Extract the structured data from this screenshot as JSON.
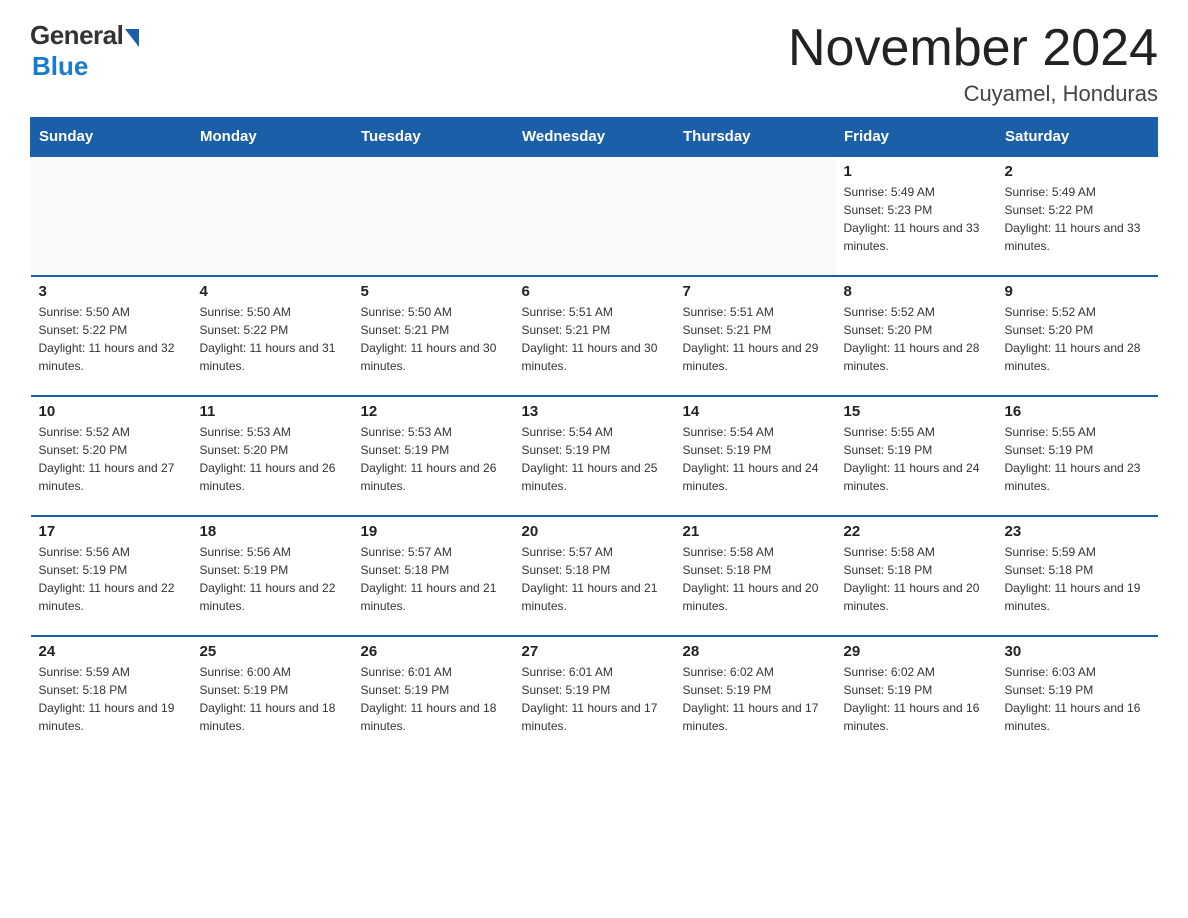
{
  "logo": {
    "general": "General",
    "blue": "Blue"
  },
  "title": "November 2024",
  "subtitle": "Cuyamel, Honduras",
  "days_of_week": [
    "Sunday",
    "Monday",
    "Tuesday",
    "Wednesday",
    "Thursday",
    "Friday",
    "Saturday"
  ],
  "weeks": [
    [
      {
        "day": "",
        "sunrise": "",
        "sunset": "",
        "daylight": ""
      },
      {
        "day": "",
        "sunrise": "",
        "sunset": "",
        "daylight": ""
      },
      {
        "day": "",
        "sunrise": "",
        "sunset": "",
        "daylight": ""
      },
      {
        "day": "",
        "sunrise": "",
        "sunset": "",
        "daylight": ""
      },
      {
        "day": "",
        "sunrise": "",
        "sunset": "",
        "daylight": ""
      },
      {
        "day": "1",
        "sunrise": "Sunrise: 5:49 AM",
        "sunset": "Sunset: 5:23 PM",
        "daylight": "Daylight: 11 hours and 33 minutes."
      },
      {
        "day": "2",
        "sunrise": "Sunrise: 5:49 AM",
        "sunset": "Sunset: 5:22 PM",
        "daylight": "Daylight: 11 hours and 33 minutes."
      }
    ],
    [
      {
        "day": "3",
        "sunrise": "Sunrise: 5:50 AM",
        "sunset": "Sunset: 5:22 PM",
        "daylight": "Daylight: 11 hours and 32 minutes."
      },
      {
        "day": "4",
        "sunrise": "Sunrise: 5:50 AM",
        "sunset": "Sunset: 5:22 PM",
        "daylight": "Daylight: 11 hours and 31 minutes."
      },
      {
        "day": "5",
        "sunrise": "Sunrise: 5:50 AM",
        "sunset": "Sunset: 5:21 PM",
        "daylight": "Daylight: 11 hours and 30 minutes."
      },
      {
        "day": "6",
        "sunrise": "Sunrise: 5:51 AM",
        "sunset": "Sunset: 5:21 PM",
        "daylight": "Daylight: 11 hours and 30 minutes."
      },
      {
        "day": "7",
        "sunrise": "Sunrise: 5:51 AM",
        "sunset": "Sunset: 5:21 PM",
        "daylight": "Daylight: 11 hours and 29 minutes."
      },
      {
        "day": "8",
        "sunrise": "Sunrise: 5:52 AM",
        "sunset": "Sunset: 5:20 PM",
        "daylight": "Daylight: 11 hours and 28 minutes."
      },
      {
        "day": "9",
        "sunrise": "Sunrise: 5:52 AM",
        "sunset": "Sunset: 5:20 PM",
        "daylight": "Daylight: 11 hours and 28 minutes."
      }
    ],
    [
      {
        "day": "10",
        "sunrise": "Sunrise: 5:52 AM",
        "sunset": "Sunset: 5:20 PM",
        "daylight": "Daylight: 11 hours and 27 minutes."
      },
      {
        "day": "11",
        "sunrise": "Sunrise: 5:53 AM",
        "sunset": "Sunset: 5:20 PM",
        "daylight": "Daylight: 11 hours and 26 minutes."
      },
      {
        "day": "12",
        "sunrise": "Sunrise: 5:53 AM",
        "sunset": "Sunset: 5:19 PM",
        "daylight": "Daylight: 11 hours and 26 minutes."
      },
      {
        "day": "13",
        "sunrise": "Sunrise: 5:54 AM",
        "sunset": "Sunset: 5:19 PM",
        "daylight": "Daylight: 11 hours and 25 minutes."
      },
      {
        "day": "14",
        "sunrise": "Sunrise: 5:54 AM",
        "sunset": "Sunset: 5:19 PM",
        "daylight": "Daylight: 11 hours and 24 minutes."
      },
      {
        "day": "15",
        "sunrise": "Sunrise: 5:55 AM",
        "sunset": "Sunset: 5:19 PM",
        "daylight": "Daylight: 11 hours and 24 minutes."
      },
      {
        "day": "16",
        "sunrise": "Sunrise: 5:55 AM",
        "sunset": "Sunset: 5:19 PM",
        "daylight": "Daylight: 11 hours and 23 minutes."
      }
    ],
    [
      {
        "day": "17",
        "sunrise": "Sunrise: 5:56 AM",
        "sunset": "Sunset: 5:19 PM",
        "daylight": "Daylight: 11 hours and 22 minutes."
      },
      {
        "day": "18",
        "sunrise": "Sunrise: 5:56 AM",
        "sunset": "Sunset: 5:19 PM",
        "daylight": "Daylight: 11 hours and 22 minutes."
      },
      {
        "day": "19",
        "sunrise": "Sunrise: 5:57 AM",
        "sunset": "Sunset: 5:18 PM",
        "daylight": "Daylight: 11 hours and 21 minutes."
      },
      {
        "day": "20",
        "sunrise": "Sunrise: 5:57 AM",
        "sunset": "Sunset: 5:18 PM",
        "daylight": "Daylight: 11 hours and 21 minutes."
      },
      {
        "day": "21",
        "sunrise": "Sunrise: 5:58 AM",
        "sunset": "Sunset: 5:18 PM",
        "daylight": "Daylight: 11 hours and 20 minutes."
      },
      {
        "day": "22",
        "sunrise": "Sunrise: 5:58 AM",
        "sunset": "Sunset: 5:18 PM",
        "daylight": "Daylight: 11 hours and 20 minutes."
      },
      {
        "day": "23",
        "sunrise": "Sunrise: 5:59 AM",
        "sunset": "Sunset: 5:18 PM",
        "daylight": "Daylight: 11 hours and 19 minutes."
      }
    ],
    [
      {
        "day": "24",
        "sunrise": "Sunrise: 5:59 AM",
        "sunset": "Sunset: 5:18 PM",
        "daylight": "Daylight: 11 hours and 19 minutes."
      },
      {
        "day": "25",
        "sunrise": "Sunrise: 6:00 AM",
        "sunset": "Sunset: 5:19 PM",
        "daylight": "Daylight: 11 hours and 18 minutes."
      },
      {
        "day": "26",
        "sunrise": "Sunrise: 6:01 AM",
        "sunset": "Sunset: 5:19 PM",
        "daylight": "Daylight: 11 hours and 18 minutes."
      },
      {
        "day": "27",
        "sunrise": "Sunrise: 6:01 AM",
        "sunset": "Sunset: 5:19 PM",
        "daylight": "Daylight: 11 hours and 17 minutes."
      },
      {
        "day": "28",
        "sunrise": "Sunrise: 6:02 AM",
        "sunset": "Sunset: 5:19 PM",
        "daylight": "Daylight: 11 hours and 17 minutes."
      },
      {
        "day": "29",
        "sunrise": "Sunrise: 6:02 AM",
        "sunset": "Sunset: 5:19 PM",
        "daylight": "Daylight: 11 hours and 16 minutes."
      },
      {
        "day": "30",
        "sunrise": "Sunrise: 6:03 AM",
        "sunset": "Sunset: 5:19 PM",
        "daylight": "Daylight: 11 hours and 16 minutes."
      }
    ]
  ]
}
